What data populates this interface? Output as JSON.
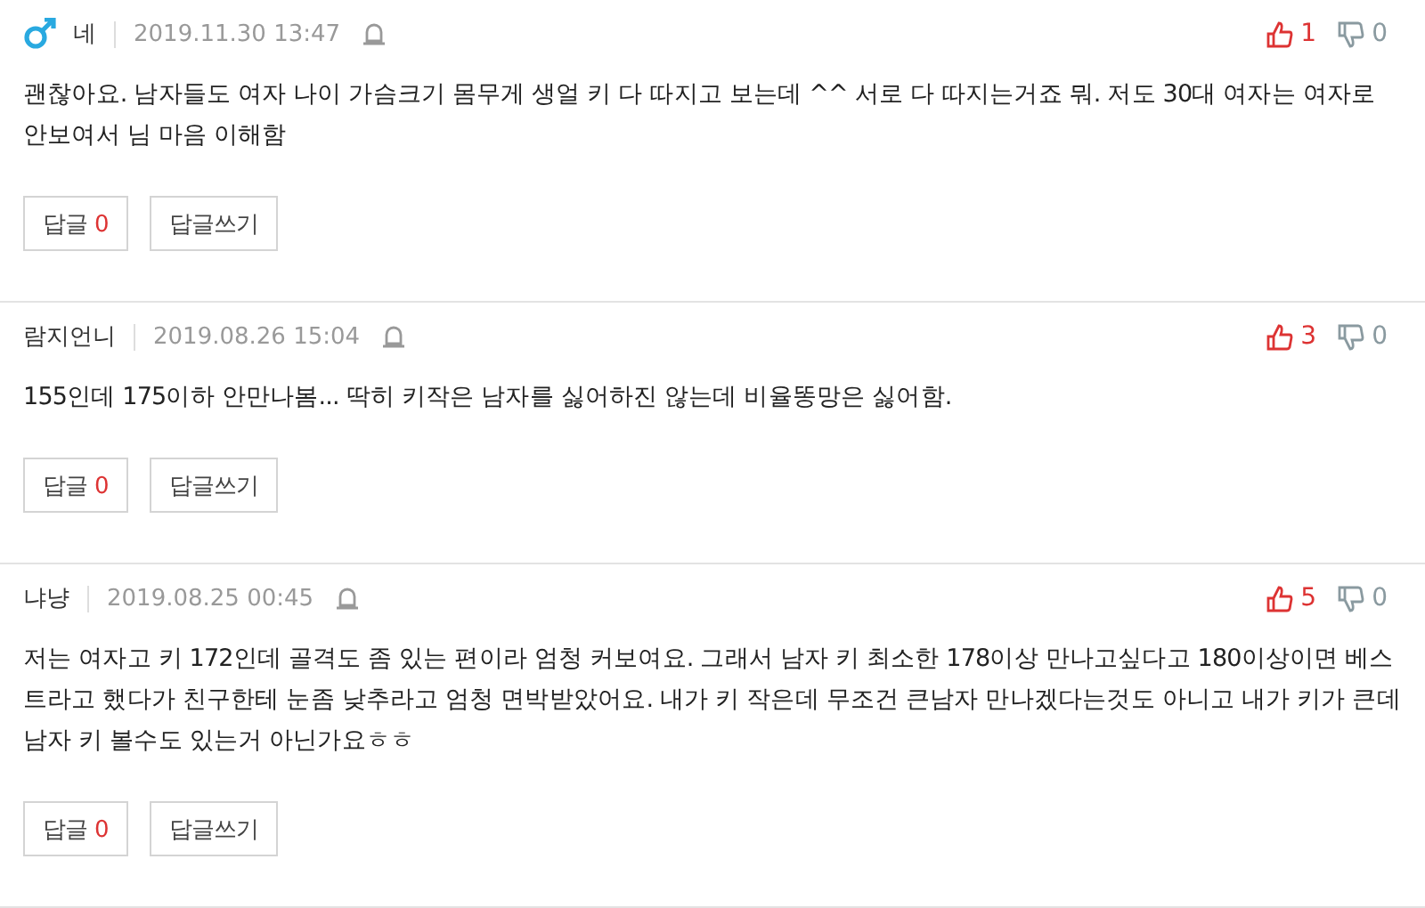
{
  "comments": [
    {
      "author": "네",
      "gender_icon": true,
      "date": "2019.11.30 13:47",
      "text": "괜찮아요. 남자들도 여자 나이 가슴크기 몸무게 생얼 키 다 따지고 보는데 ^^ 서로 다 따지는거죠 뭐. 저도 30대 여자는 여자로 안보여서 님 마음 이해함",
      "likes": "1",
      "dislikes": "0",
      "reply_label": "답글",
      "reply_count": "0",
      "write_label": "답글쓰기"
    },
    {
      "author": "람지언니",
      "gender_icon": false,
      "date": "2019.08.26 15:04",
      "text": "155인데 175이하 안만나봄... 딱히 키작은 남자를 싫어하진 않는데 비율똥망은 싫어함.",
      "likes": "3",
      "dislikes": "0",
      "reply_label": "답글",
      "reply_count": "0",
      "write_label": "답글쓰기"
    },
    {
      "author": "냐냥",
      "gender_icon": false,
      "date": "2019.08.25 00:45",
      "text": "저는 여자고 키 172인데 골격도 좀 있는 편이라 엄청 커보여요. 그래서 남자 키 최소한 178이상 만나고싶다고 180이상이면 베스트라고 했다가 친구한테 눈좀 낮추라고 엄청 면박받았어요. 내가 키 작은데 무조건 큰남자 만나겠다는것도 아니고 내가 키가 큰데 남자 키 볼수도 있는거 아닌가요ㅎㅎ",
      "likes": "5",
      "dislikes": "0",
      "reply_label": "답글",
      "reply_count": "0",
      "write_label": "답글쓰기"
    }
  ]
}
